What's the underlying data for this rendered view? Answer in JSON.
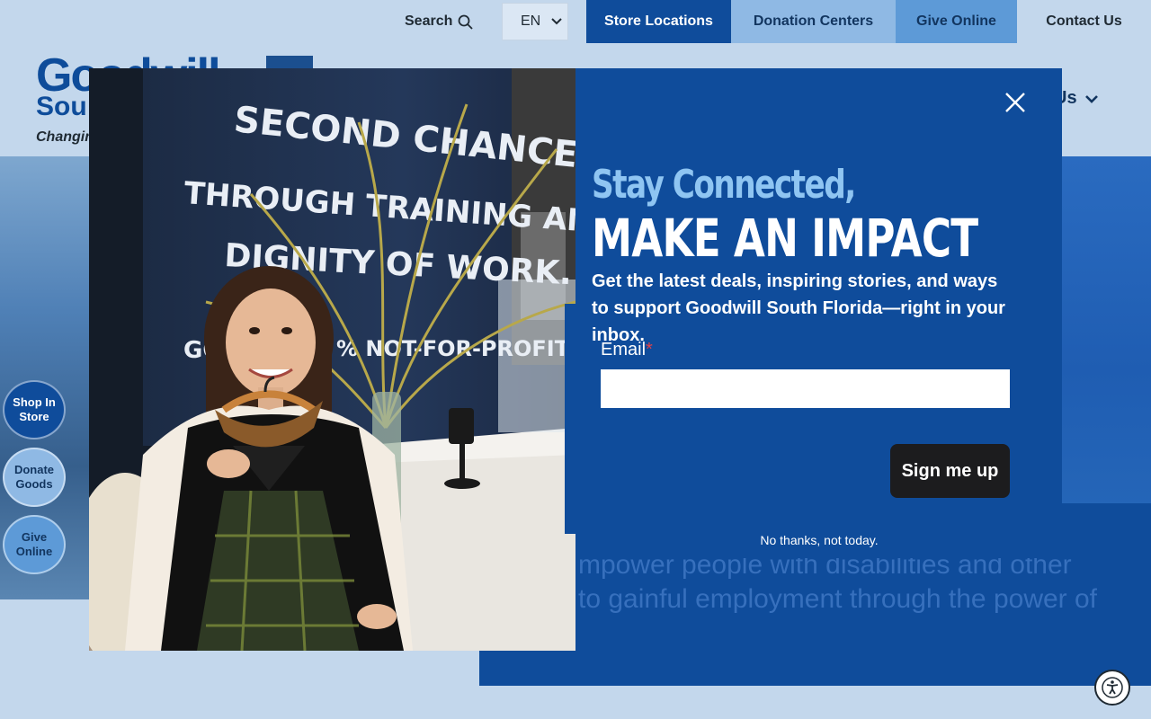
{
  "topbar": {
    "search_label": "Search",
    "language": "EN",
    "store_locations": "Store Locations",
    "donation_centers": "Donation Centers",
    "give_online": "Give Online",
    "contact_us": "Contact Us"
  },
  "header": {
    "logo_text": "Goodwill",
    "logo_sub": "Sou",
    "tagline": "Changin",
    "nav_partial": "Us"
  },
  "hero": {
    "card_text": "mpower people with disabilities and other\nto gainful employment through the power of"
  },
  "float_buttons": [
    {
      "label": "Shop In Store"
    },
    {
      "label": "Donate Goods"
    },
    {
      "label": "Give Online"
    }
  ],
  "modal": {
    "title_line1": "Stay Connected,",
    "title_line2": "MAKE AN IMPACT",
    "description": "Get the latest deals, inspiring stories, and ways to support Goodwill South Florida—right in your inbox.",
    "email_label": "Email",
    "email_required_marker": "*",
    "email_value": "",
    "submit_label": "Sign me up",
    "decline_label": "No thanks, not today."
  },
  "photo": {
    "wall_text_lines": [
      "SECOND CHANCES",
      "THROUGH TRAINING AND THE",
      "DIGNITY OF WORK.",
      "GOO",
      "% NOT-FOR-PROFIT."
    ]
  },
  "colors": {
    "brand_blue": "#0f4c9b",
    "light_blue": "#8fb9e4",
    "mid_blue": "#5d9ad7",
    "page_bg": "#c3d7ec",
    "title_accent": "#8fc5f2",
    "button_dark": "#1c1c1e",
    "required_red": "#e0424a"
  },
  "icons": {
    "search": "search-icon",
    "close": "close-icon",
    "chevron": "chevron-down-icon",
    "accessibility": "accessibility-icon"
  }
}
